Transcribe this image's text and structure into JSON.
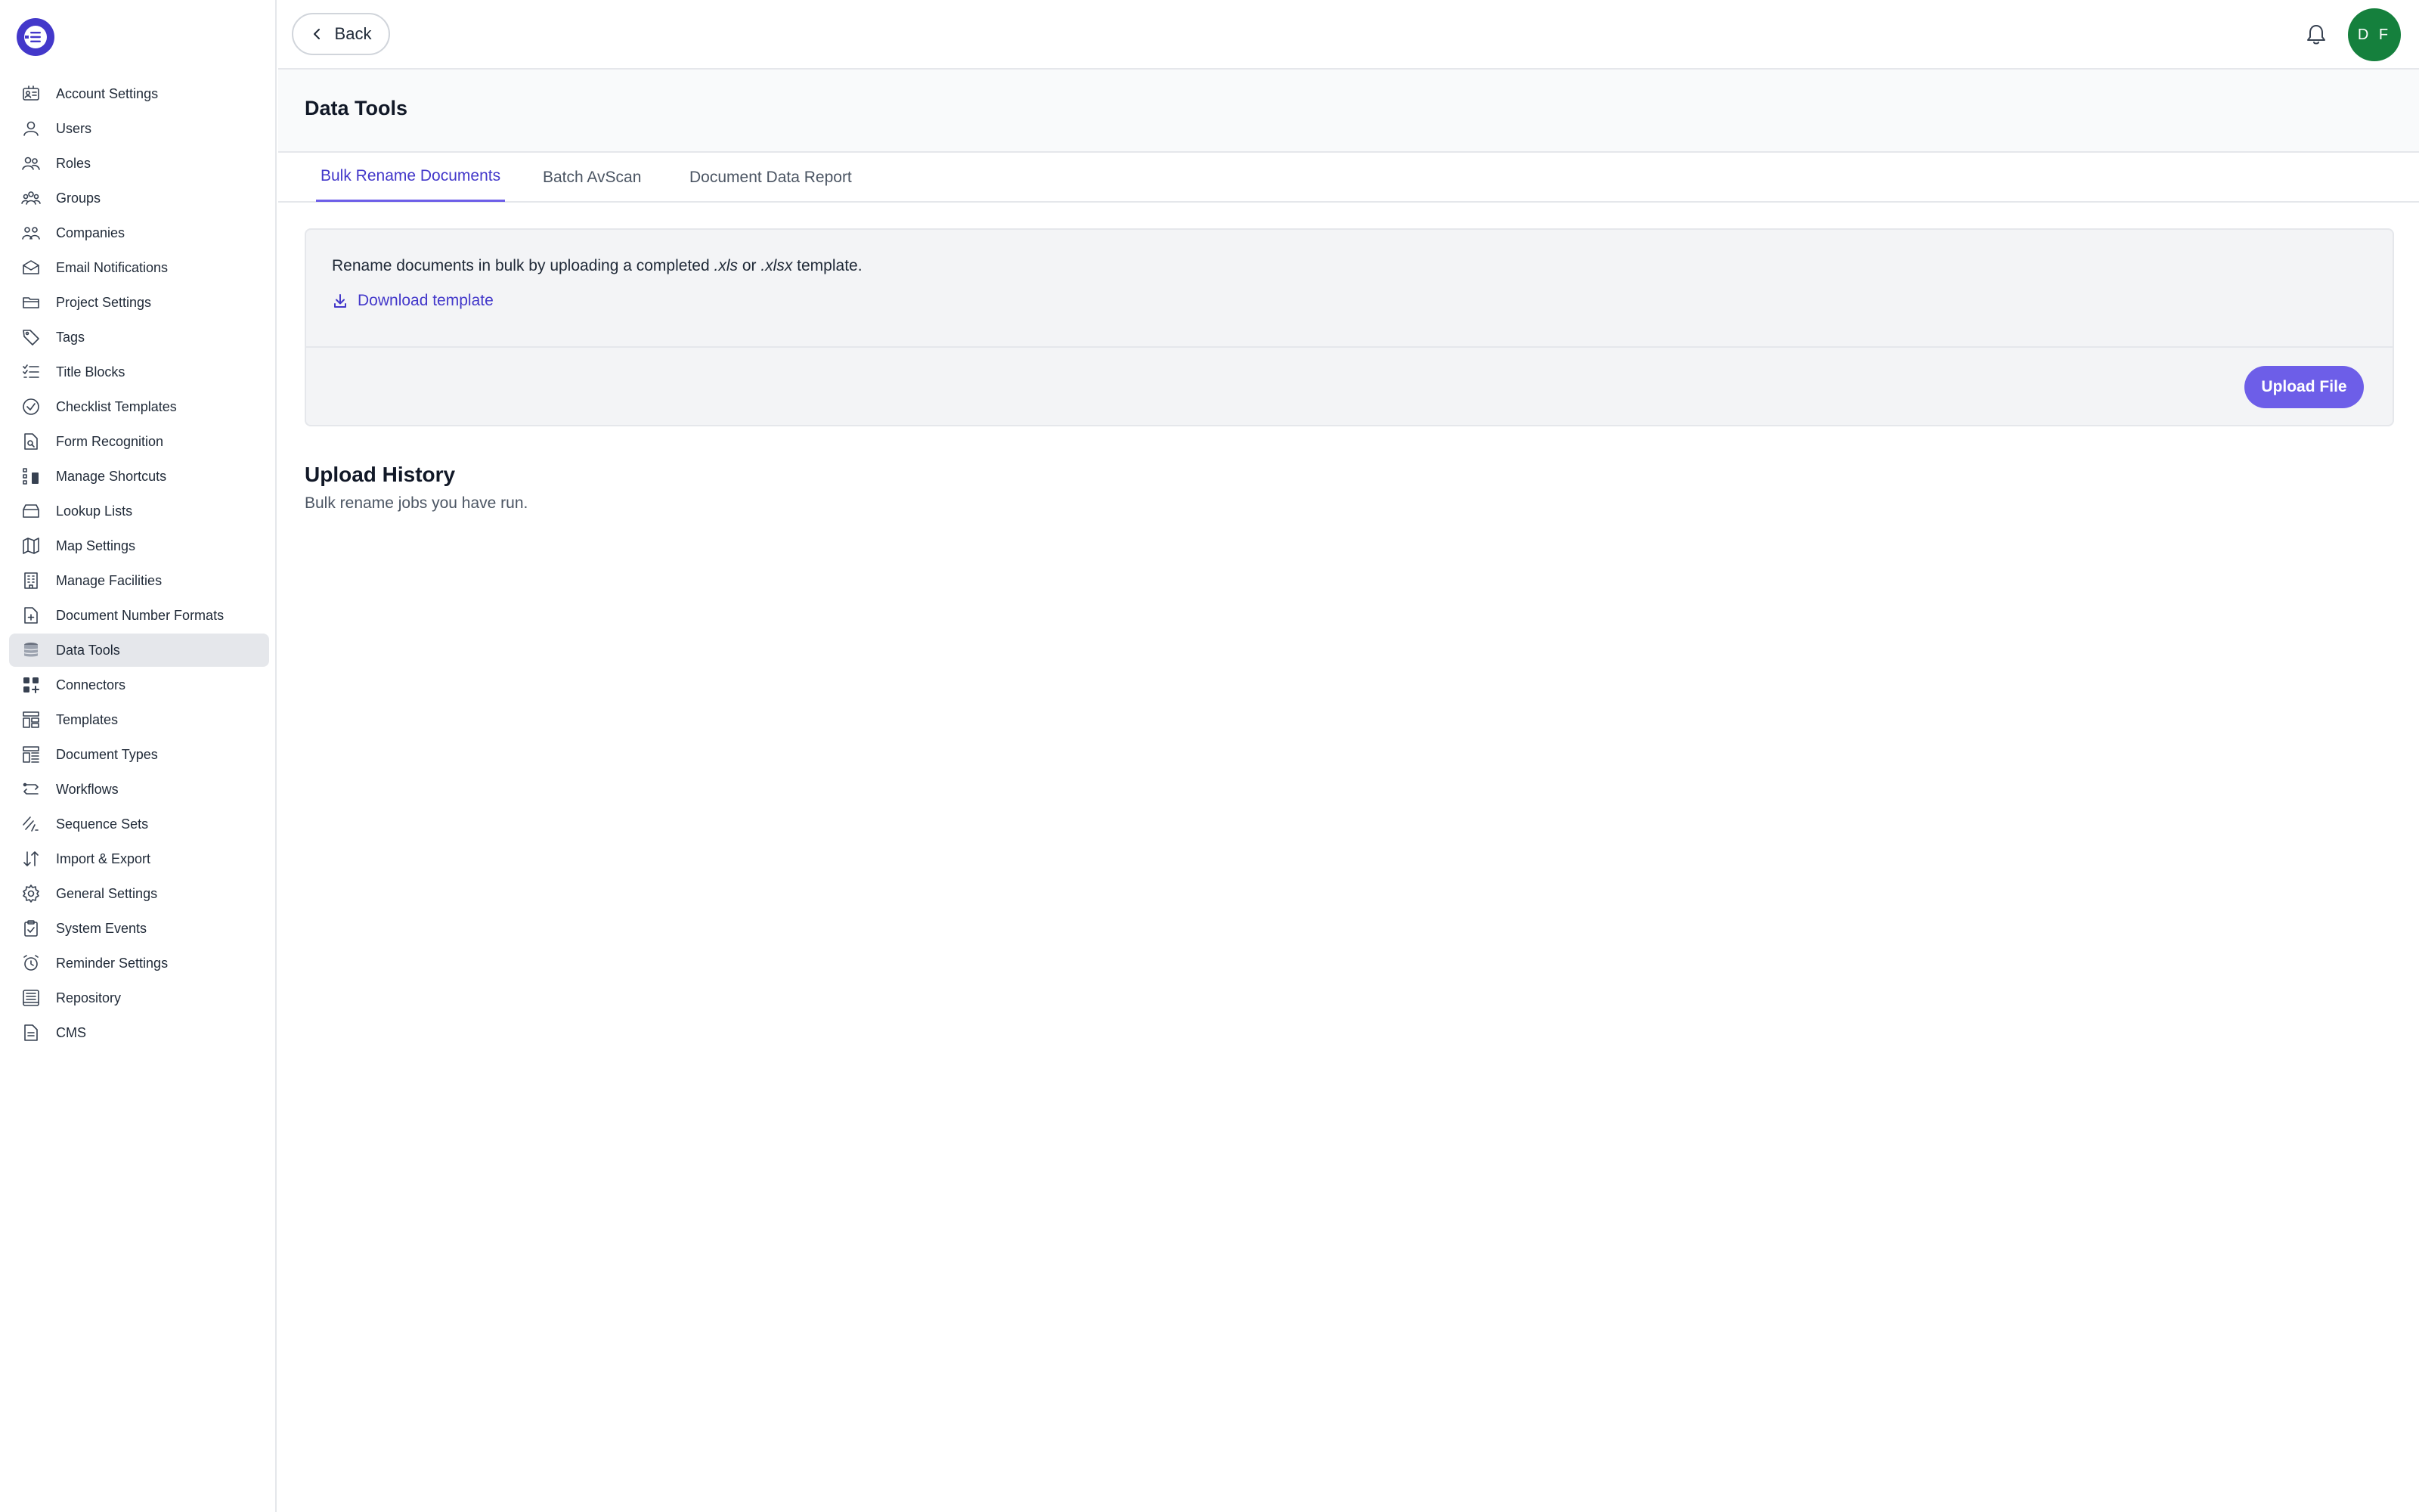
{
  "sidebar": {
    "items": [
      {
        "label": "Account Settings",
        "icon": "id-card-icon"
      },
      {
        "label": "Users",
        "icon": "user-icon"
      },
      {
        "label": "Roles",
        "icon": "users-roles-icon"
      },
      {
        "label": "Groups",
        "icon": "group-icon"
      },
      {
        "label": "Companies",
        "icon": "companies-icon"
      },
      {
        "label": "Email Notifications",
        "icon": "mail-icon"
      },
      {
        "label": "Project Settings",
        "icon": "folder-icon"
      },
      {
        "label": "Tags",
        "icon": "tag-icon"
      },
      {
        "label": "Title Blocks",
        "icon": "list-check-icon"
      },
      {
        "label": "Checklist Templates",
        "icon": "check-circle-icon"
      },
      {
        "label": "Form Recognition",
        "icon": "doc-search-icon"
      },
      {
        "label": "Manage Shortcuts",
        "icon": "shortcut-icon"
      },
      {
        "label": "Lookup Lists",
        "icon": "archive-icon"
      },
      {
        "label": "Map Settings",
        "icon": "map-icon"
      },
      {
        "label": "Manage Facilities",
        "icon": "building-icon"
      },
      {
        "label": "Document Number Formats",
        "icon": "doc-plus-icon"
      },
      {
        "label": "Data Tools",
        "icon": "database-icon",
        "active": true
      },
      {
        "label": "Connectors",
        "icon": "grid-plus-icon"
      },
      {
        "label": "Templates",
        "icon": "template-icon"
      },
      {
        "label": "Document Types",
        "icon": "doc-types-icon"
      },
      {
        "label": "Workflows",
        "icon": "workflow-icon"
      },
      {
        "label": "Sequence Sets",
        "icon": "sequence-icon"
      },
      {
        "label": "Import & Export",
        "icon": "arrows-updown-icon"
      },
      {
        "label": "General Settings",
        "icon": "gear-icon"
      },
      {
        "label": "System Events",
        "icon": "clipboard-check-icon"
      },
      {
        "label": "Reminder Settings",
        "icon": "alarm-icon"
      },
      {
        "label": "Repository",
        "icon": "repository-icon"
      },
      {
        "label": "CMS",
        "icon": "file-text-icon"
      }
    ]
  },
  "topbar": {
    "back_label": "Back",
    "avatar_initials": "D F"
  },
  "page": {
    "title": "Data Tools"
  },
  "tabs": [
    {
      "label": "Bulk Rename Documents",
      "active": true
    },
    {
      "label": "Batch AvScan",
      "active": false
    },
    {
      "label": "Document Data Report",
      "active": false
    }
  ],
  "panel": {
    "text_before": "Rename documents in bulk by uploading a completed ",
    "ext1": ".xls",
    "text_mid": " or ",
    "ext2": ".xlsx",
    "text_after": " template.",
    "download_label": "Download template",
    "upload_label": "Upload File"
  },
  "history": {
    "title": "Upload History",
    "subtitle": "Bulk rename jobs you have run."
  },
  "colors": {
    "accent": "#6d5ee8",
    "accent_text": "#4338ca",
    "avatar": "#15803d"
  }
}
